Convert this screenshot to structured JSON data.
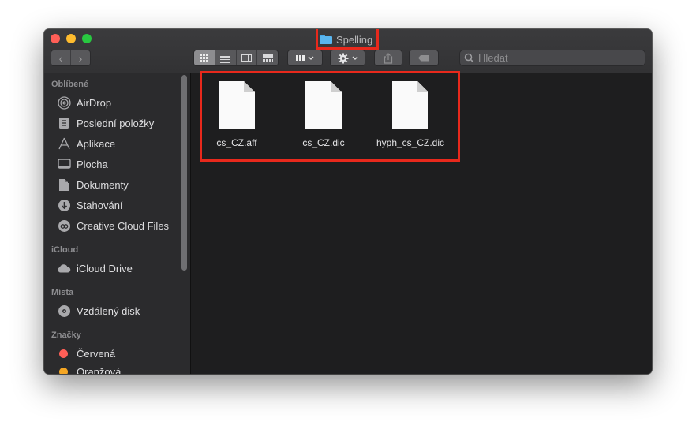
{
  "window": {
    "title": "Spelling",
    "traffic_lights": [
      "close",
      "minimize",
      "maximize"
    ]
  },
  "toolbar": {
    "back_icon": "‹",
    "forward_icon": "›",
    "view_modes": [
      "icon-view-icon",
      "list-view-icon",
      "column-view-icon",
      "gallery-view-icon"
    ],
    "active_view": "icon-view-icon",
    "search_placeholder": "Hledat"
  },
  "sidebar": {
    "favorites_label": "Oblíbené",
    "favorites": [
      {
        "label": "AirDrop",
        "icon": "airdrop-icon"
      },
      {
        "label": "Poslední položky",
        "icon": "recents-icon"
      },
      {
        "label": "Aplikace",
        "icon": "applications-icon"
      },
      {
        "label": "Plocha",
        "icon": "desktop-icon"
      },
      {
        "label": "Dokumenty",
        "icon": "documents-icon"
      },
      {
        "label": "Stahování",
        "icon": "downloads-icon"
      },
      {
        "label": "Creative Cloud Files",
        "icon": "creative-cloud-icon"
      }
    ],
    "icloud_label": "iCloud",
    "icloud": [
      {
        "label": "iCloud Drive",
        "icon": "cloud-icon"
      }
    ],
    "locations_label": "Místa",
    "locations": [
      {
        "label": "Vzdálený disk",
        "icon": "disk-icon"
      }
    ],
    "tags_label": "Značky",
    "tags": [
      {
        "label": "Červená",
        "color": "#ff5f57"
      },
      {
        "label": "Oranžová",
        "color": "#f5a623"
      }
    ]
  },
  "files": [
    {
      "name": "cs_CZ.aff"
    },
    {
      "name": "cs_CZ.dic"
    },
    {
      "name": "hyph_cs_CZ.dic"
    }
  ],
  "colors": {
    "highlight": "#e8291c",
    "folder": "#5ab6ef"
  }
}
